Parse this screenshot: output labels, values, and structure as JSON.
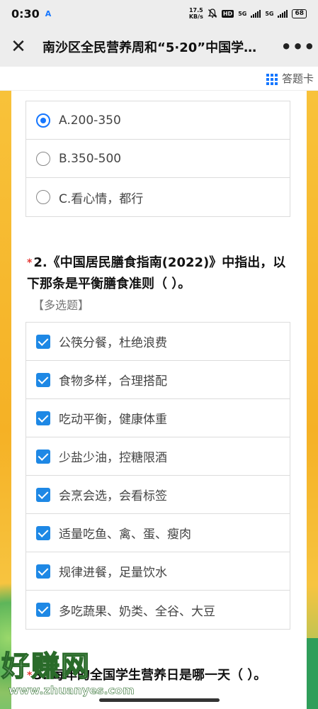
{
  "status_bar": {
    "time": "0:30",
    "app_badge": "A",
    "speed_top": "17.5",
    "speed_bottom": "KB/s",
    "hd": "HD",
    "net1": "5G",
    "net2": "5G",
    "battery": "68"
  },
  "title_bar": {
    "close_glyph": "✕",
    "title": "南沙区全民营养周和“5·20”中国学…",
    "more_glyph": "•••"
  },
  "answer_card": {
    "label": "答题卡"
  },
  "question1": {
    "options": [
      {
        "label": "A.200-350",
        "selected": true
      },
      {
        "label": "B.350-500",
        "selected": false
      },
      {
        "label": "C.看心情，都行",
        "selected": false
      }
    ]
  },
  "question2": {
    "required_mark": "*",
    "title": "2.《中国居民膳食指南(2022)》中指出，以下那条是平衡膳食准则（ ）。",
    "type_label": "【多选题】",
    "options": [
      {
        "label": "公筷分餐，杜绝浪费",
        "checked": true
      },
      {
        "label": "食物多样，合理搭配",
        "checked": true
      },
      {
        "label": "吃动平衡，健康体重",
        "checked": true
      },
      {
        "label": "少盐少油，控糖限酒",
        "checked": true
      },
      {
        "label": "会烹会选，会看标签",
        "checked": true
      },
      {
        "label": "适量吃鱼、禽、蛋、瘦肉",
        "checked": true
      },
      {
        "label": "规律进餐，足量饮水",
        "checked": true
      },
      {
        "label": "多吃蔬果、奶类、全谷、大豆",
        "checked": true
      }
    ]
  },
  "question3": {
    "required_mark": "*",
    "title": "3. 每年的全国学生营养日是哪一天（ ）。"
  },
  "watermark": {
    "text": "好赚网",
    "url": "www.zhuanyes.com"
  },
  "colors": {
    "accent": "#1677ff",
    "checkbox": "#1e88e5",
    "required": "#e53935",
    "background": "#f6b92c"
  }
}
